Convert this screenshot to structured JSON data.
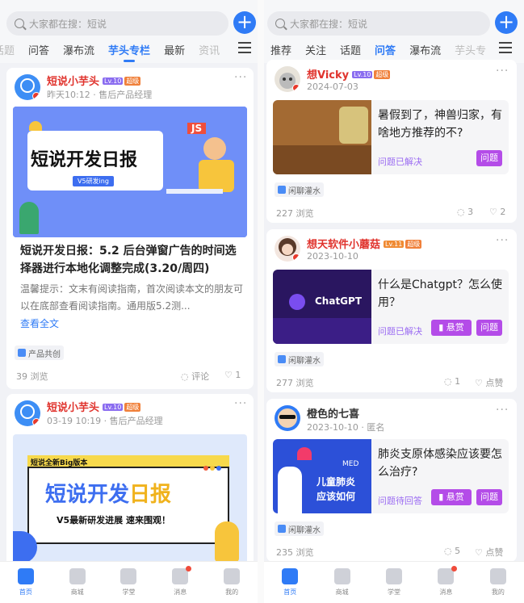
{
  "search_placeholder": "大家都在搜：短说",
  "plus": "+",
  "left": {
    "tabs": [
      "话题",
      "问答",
      "瀑布流",
      "芋头专栏",
      "最新",
      "资讯"
    ],
    "post1": {
      "name": "短说小芋头",
      "lv": "Lv.10",
      "sup": "超级",
      "meta": "昨天10:12 · 售后产品经理",
      "banner_title": "短说开发日报",
      "banner_sub": "V5研发ing",
      "banner_tag": "JS",
      "title": "短说开发日报：5.2 后台弹窗广告的时间选择器进行本地化调整完成(3.20/周四)",
      "excerpt": "温馨提示：文末有阅读指南，首次阅读本文的朋友可以在底部查看阅读指南。通用版5.2测...",
      "read_more": "查看全文",
      "tag": "产品共创",
      "views": "39 浏览",
      "comments": "评论",
      "likes": "1"
    },
    "post2": {
      "name": "短说小芋头",
      "lv": "Lv.10",
      "sup": "超级",
      "meta": "03-19 10:19 · 售后产品经理",
      "banner_top": "短说全新Big版本",
      "banner_title1": "短说开发",
      "banner_title2": "日报",
      "banner_sub": "V5最新研发进展 速来围观！"
    }
  },
  "right": {
    "tabs": [
      "推荐",
      "关注",
      "话题",
      "问答",
      "瀑布流",
      "芋头专"
    ],
    "q1": {
      "name": "想Vicky",
      "lv": "Lv.10",
      "sup": "超级",
      "meta": "2024-07-03",
      "title": "暑假到了，神兽归家，有啥地方推荐的不?",
      "state": "问题已解决",
      "btn": "问题",
      "tag": "闲聊灌水",
      "views": "227 浏览",
      "comments": "3",
      "likes": "2"
    },
    "q2": {
      "name": "想天软件小蘑菇",
      "lv": "Lv.11",
      "sup": "超级",
      "meta": "2023-10-10",
      "img_text": "ChatGPT",
      "title": "什么是Chatgpt？怎么使用？",
      "state": "问题已解决",
      "reward": "悬赏",
      "btn": "问题",
      "tag": "闲聊灌水",
      "views": "277 浏览",
      "comments": "1",
      "likes": "点赞"
    },
    "q3": {
      "name": "橙色的七喜",
      "meta": "2023-10-10 · 匿名",
      "img_text1": "MED",
      "img_text2": "儿童肺炎",
      "img_text3": "应该如何",
      "title": "肺炎支原体感染应该要怎么治疗?",
      "state": "问题待回答",
      "reward": "悬赏",
      "btn": "问题",
      "tag": "闲聊灌水",
      "views": "235 浏览",
      "comments": "5",
      "likes": "点赞"
    }
  },
  "nav": [
    "首页",
    "商城",
    "学堂",
    "消息",
    "我的"
  ]
}
